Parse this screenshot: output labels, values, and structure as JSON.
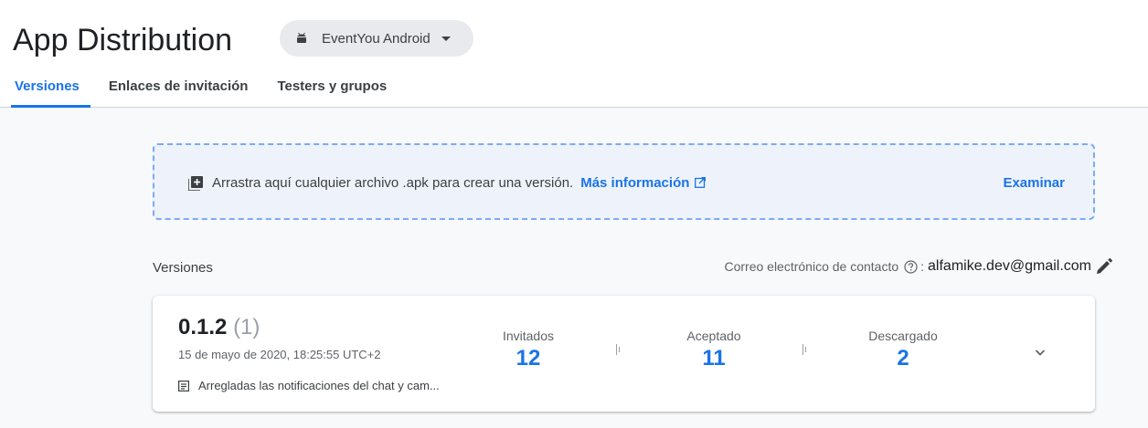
{
  "header": {
    "title": "App Distribution",
    "app_selector": {
      "label": "EventYou Android",
      "icon": "android-icon"
    },
    "tabs": [
      {
        "label": "Versiones",
        "active": true
      },
      {
        "label": "Enlaces de invitación",
        "active": false
      },
      {
        "label": "Testers y grupos",
        "active": false
      }
    ]
  },
  "dropzone": {
    "icon": "add-box-icon",
    "text": "Arrastra aquí cualquier archivo .apk para crear una versión.",
    "link": "Más información",
    "browse": "Examinar"
  },
  "versions_section": {
    "label": "Versiones",
    "contact_label": "Correo electrónico de contacto",
    "contact_colon": ":",
    "contact_email": "alfamike.dev@gmail.com"
  },
  "release": {
    "version": "0.1.2",
    "build": "(1)",
    "date": "15 de mayo de 2020, 18:25:55 UTC+2",
    "note": "Arregladas las notificaciones del chat y cam...",
    "stats": [
      {
        "label": "Invitados",
        "value": "12"
      },
      {
        "label": "Aceptado",
        "value": "11"
      },
      {
        "label": "Descargado",
        "value": "2"
      }
    ]
  },
  "colors": {
    "accent": "#1a73e8",
    "dropzone_border": "#7baaf7",
    "dropzone_bg": "#eef3fb",
    "chip_bg": "#e8eaed"
  }
}
